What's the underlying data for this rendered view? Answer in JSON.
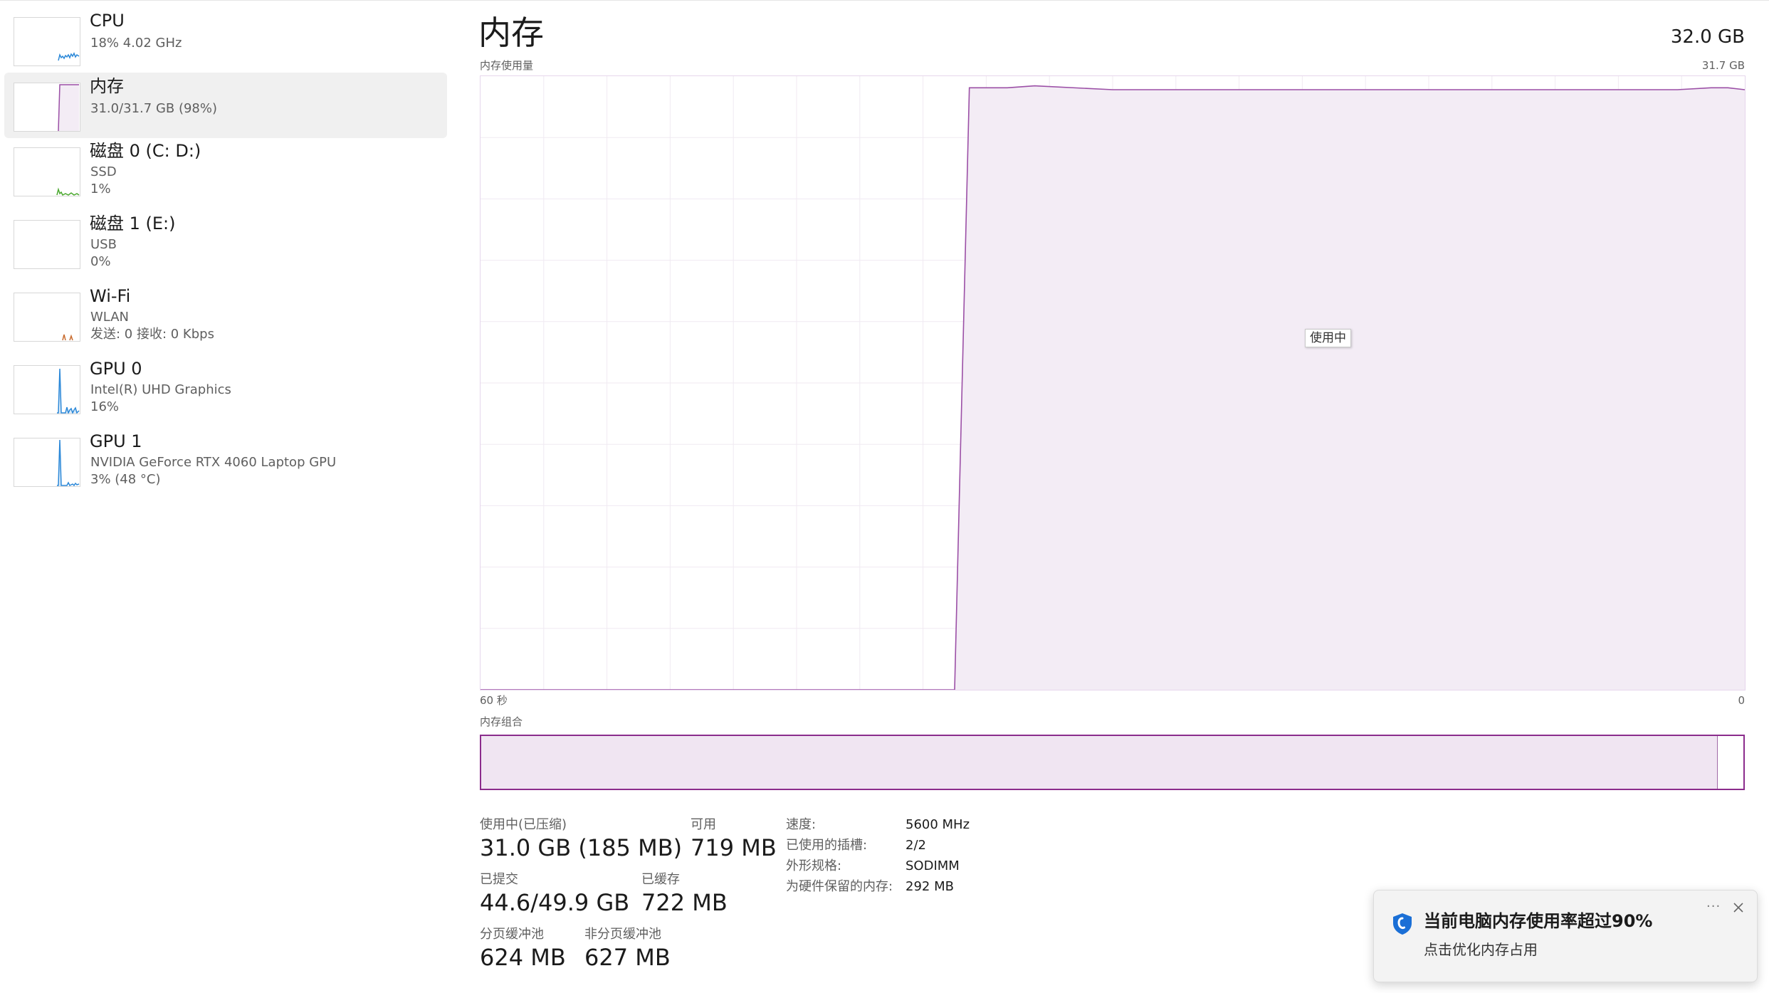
{
  "sidebar": {
    "items": [
      {
        "title": "CPU",
        "line1": "18% 4.02 GHz",
        "line2": ""
      },
      {
        "title": "内存",
        "line1": "31.0/31.7 GB (98%)",
        "line2": ""
      },
      {
        "title": "磁盘 0 (C: D:)",
        "line1": "SSD",
        "line2": "1%"
      },
      {
        "title": "磁盘 1 (E:)",
        "line1": "USB",
        "line2": "0%"
      },
      {
        "title": "Wi-Fi",
        "line1": "WLAN",
        "line2": "发送: 0 接收: 0 Kbps"
      },
      {
        "title": "GPU 0",
        "line1": "Intel(R) UHD Graphics",
        "line2": "16%"
      },
      {
        "title": "GPU 1",
        "line1": "NVIDIA GeForce RTX 4060 Laptop GPU",
        "line2": "3% (48 °C)"
      }
    ]
  },
  "header": {
    "title": "内存",
    "total": "32.0 GB"
  },
  "graph": {
    "label": "内存使用量",
    "max_label": "31.7 GB",
    "time_left": "60 秒",
    "time_right": "0",
    "tooltip": "使用中",
    "line_color": "#9b4fa6",
    "fill_color": "#f3ecf5"
  },
  "chart_data": {
    "type": "area",
    "xlabel": "60 秒",
    "ylabel": "内存使用量",
    "x": [
      60,
      40,
      37.5,
      36.8,
      35,
      33.7,
      30,
      24,
      21.5,
      20.2,
      17.4,
      16.8,
      15.2,
      13.6,
      12.6,
      11.8,
      10.3,
      9.3,
      4.5,
      3.2,
      1.6,
      0.8,
      0
    ],
    "series": [
      {
        "values": [
          0,
          0,
          0,
          31.1,
          31.1,
          31.2,
          31.0,
          31.0,
          31.0,
          31.0,
          31.0,
          31.0,
          31.0,
          31.0,
          31.0,
          31.0,
          31.0,
          31.0,
          31.0,
          31.0,
          31.1,
          31.1,
          31.0
        ]
      }
    ],
    "ylim": [
      0,
      31.7
    ],
    "xlim": [
      60,
      0
    ],
    "grid": true
  },
  "composition": {
    "label": "内存组合",
    "used_fraction": 0.979
  },
  "stats": {
    "in_use_label": "使用中(已压缩)",
    "in_use_value": "31.0 GB (185 MB)",
    "available_label": "可用",
    "available_value": "719 MB",
    "committed_label": "已提交",
    "committed_value": "44.6/49.9 GB",
    "cached_label": "已缓存",
    "cached_value": "722 MB",
    "paged_label": "分页缓冲池",
    "paged_value": "624 MB",
    "nonpaged_label": "非分页缓冲池",
    "nonpaged_value": "627 MB"
  },
  "details": {
    "speed_key": "速度:",
    "speed_val": "5600 MHz",
    "slots_key": "已使用的插槽:",
    "slots_val": "2/2",
    "form_key": "外形规格:",
    "form_val": "SODIMM",
    "reserved_key": "为硬件保留的内存:",
    "reserved_val": "292 MB"
  },
  "toast": {
    "title": "当前电脑内存使用率超过90%",
    "message": "点击优化内存占用",
    "more": "···",
    "icon": "shield-icon",
    "accent": "#1a6fd6"
  }
}
